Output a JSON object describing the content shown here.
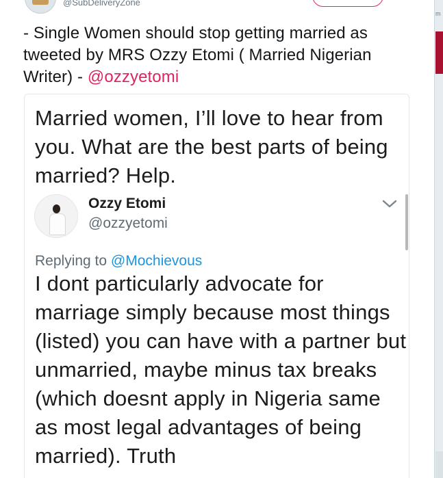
{
  "header": {
    "handle": "@SubDeliveryZone"
  },
  "side_panel": {
    "fragment": "m"
  },
  "tweet": {
    "text": "- Single Women should stop getting married as tweeted by MRS Ozzy Etomi ( Married Nigerian Writer) - ",
    "mention": "@ozzyetomi"
  },
  "media": {
    "question": "Married women, I’ll love to hear from you. What are the best parts of being married? Help.",
    "reply": {
      "name": "Ozzy Etomi",
      "handle": "@ozzyetomi",
      "replying_prefix": "Replying to ",
      "replying_to": "@Mochievous",
      "text": "I dont particularly advocate for marriage simply because most things (listed) you can have with a partner but unmarried, maybe minus tax breaks (which doesnt apply in Nigeria same as most legal advantages of being married). Truth"
    }
  },
  "colors": {
    "mention": "#e0245e",
    "link_blue": "#1b95e0",
    "strip_red": "#a8112f"
  },
  "icons": {
    "chevron": "chevron-down-icon"
  }
}
